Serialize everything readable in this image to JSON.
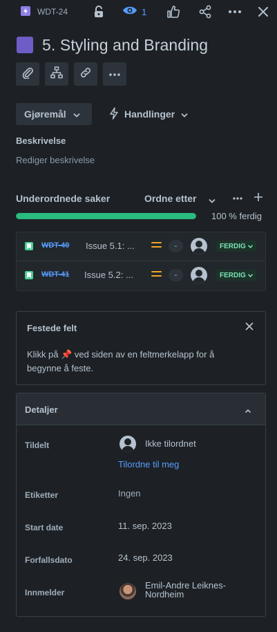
{
  "topbar": {
    "issue_key": "WDT-24",
    "watch_count": "1",
    "icons": [
      "lightning-icon",
      "unlock-icon",
      "eye-icon",
      "thumbs-up-icon",
      "share-icon",
      "more-icon",
      "close-icon"
    ]
  },
  "issue": {
    "title": "5. Styling and Branding"
  },
  "quick_actions": [
    "attachment-icon",
    "hierarchy-icon",
    "link-icon",
    "more-icon"
  ],
  "status_button": {
    "label": "Gjøremål"
  },
  "actions_button": {
    "label": "Handlinger"
  },
  "description": {
    "label": "Beskrivelse",
    "placeholder": "Rediger beskrivelse"
  },
  "child_issues": {
    "title": "Underordnede saker",
    "sort_label": "Ordne etter",
    "progress_percent": 100,
    "progress_text": "100 % ferdig",
    "items": [
      {
        "key": "WDT-40",
        "summary": "Issue 5.1: ...",
        "estimate": "-",
        "status": "FERDIG"
      },
      {
        "key": "WDT-41",
        "summary": "Issue 5.2: ...",
        "estimate": "-",
        "status": "FERDIG"
      }
    ]
  },
  "pinned_fields": {
    "title": "Festede felt",
    "text": "Klikk på 📌 ved siden av en feltmerkelapp for å begynne å feste."
  },
  "details": {
    "title": "Detaljer",
    "assignee_label": "Tildelt",
    "assignee_value": "Ikke tilordnet",
    "assign_me": "Tilordne til meg",
    "labels_label": "Etiketter",
    "labels_value": "Ingen",
    "start_label": "Start date",
    "start_value": "11. sep. 2023",
    "due_label": "Forfallsdato",
    "due_value": "24. sep. 2023",
    "reporter_label": "Innmelder",
    "reporter_value": "Emil-Andre Leiknes-Nordheim"
  },
  "colors": {
    "background": "#1d2125",
    "accent_link": "#579dff",
    "progress": "#2abb7f",
    "epic": "#6e5dc6",
    "priority": "#f5a623",
    "done_lozenge_bg": "#1c3329",
    "done_lozenge_text": "#7ee2b8"
  }
}
